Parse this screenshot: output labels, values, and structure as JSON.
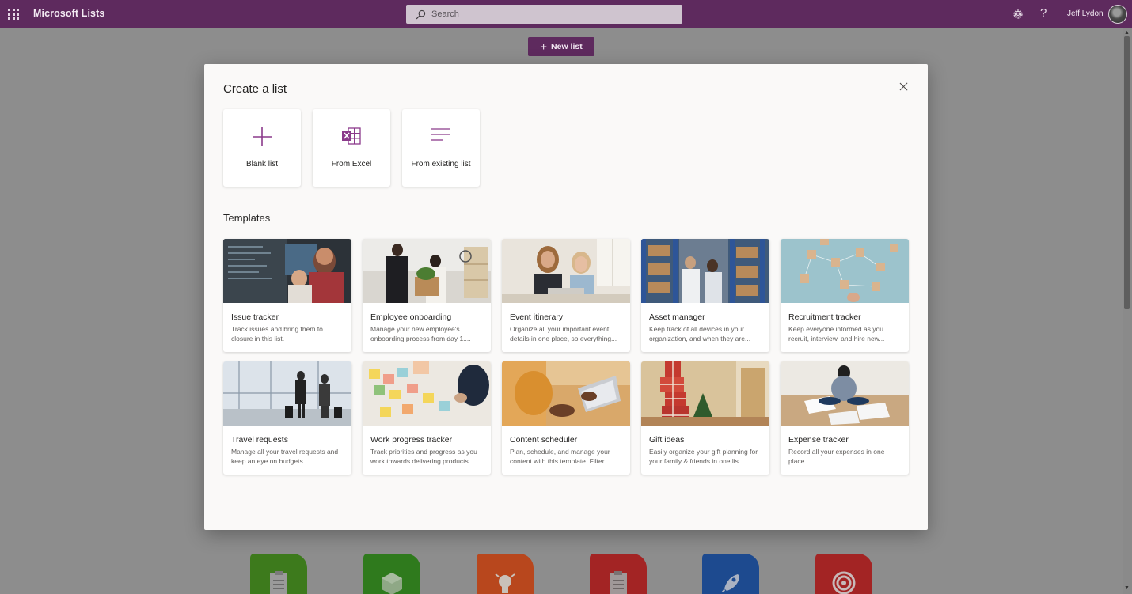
{
  "topbar": {
    "app_title": "Microsoft Lists",
    "search_placeholder": "Search",
    "user_name": "Jeff Lydon",
    "icons": [
      "app-launcher-icon",
      "search-icon",
      "gear-icon",
      "help-icon",
      "avatar"
    ]
  },
  "page": {
    "new_list_label": "New list"
  },
  "modal": {
    "title": "Create a list",
    "close_icon": "close-icon",
    "start_options": [
      {
        "label": "Blank list",
        "icon": "plus-icon"
      },
      {
        "label": "From Excel",
        "icon": "excel-icon"
      },
      {
        "label": "From existing list",
        "icon": "list-lines-icon"
      }
    ],
    "templates_heading": "Templates",
    "templates": [
      {
        "name": "Issue tracker",
        "description": "Track issues and bring them to closure in this list."
      },
      {
        "name": "Employee onboarding",
        "description": "Manage your new employee's onboarding process from day 1...."
      },
      {
        "name": "Event itinerary",
        "description": "Organize all your important event details in one place, so everything..."
      },
      {
        "name": "Asset manager",
        "description": "Keep track of all devices in your organization, and when they are..."
      },
      {
        "name": "Recruitment tracker",
        "description": "Keep everyone informed as you recruit, interview, and hire new..."
      },
      {
        "name": "Travel requests",
        "description": "Manage all your travel requests and keep an eye on budgets."
      },
      {
        "name": "Work progress tracker",
        "description": "Track priorities and progress as you work towards delivering products..."
      },
      {
        "name": "Content scheduler",
        "description": "Plan, schedule, and manage your content with this template. Filter..."
      },
      {
        "name": "Gift ideas",
        "description": "Easily organize your gift planning for your family & friends in one lis..."
      },
      {
        "name": "Expense tracker",
        "description": "Record all your expenses in one place."
      }
    ]
  },
  "colors": {
    "suite_bar": "#5e2a5e",
    "accent": "#8b3a8b",
    "overlay_bg": "#8d8d8d"
  }
}
